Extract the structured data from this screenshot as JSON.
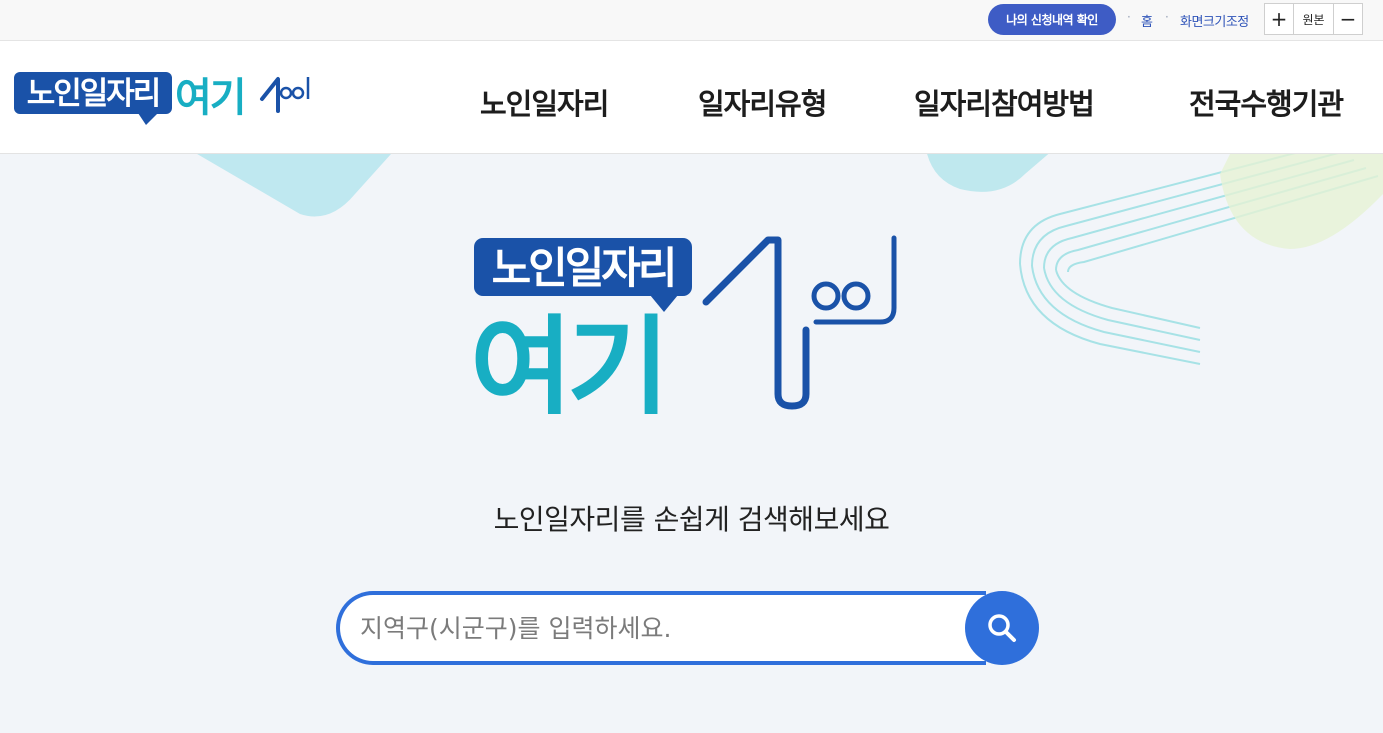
{
  "utility": {
    "my_apply_label": "나의 신청내역 확인",
    "home_label": "홈",
    "zoom_label": "화면크기조정",
    "zoom_in": "+",
    "zoom_reset": "원본",
    "zoom_out": "−"
  },
  "logo": {
    "top_text": "노인일자리",
    "bottom_text": "여기"
  },
  "nav": {
    "items": [
      "노인일자리",
      "일자리유형",
      "일자리참여방법",
      "전국수행기관"
    ]
  },
  "hero": {
    "logo_top_text": "노인일자리",
    "logo_bottom_text": "여기",
    "tagline": "노인일자리를 손쉽게 검색해보세요"
  },
  "search": {
    "placeholder": "지역구(시군구)를 입력하세요."
  },
  "colors": {
    "brand_blue": "#1a52a8",
    "brand_teal": "#18aec3",
    "accent": "#2f6fdb",
    "button": "#3e5cc5"
  }
}
